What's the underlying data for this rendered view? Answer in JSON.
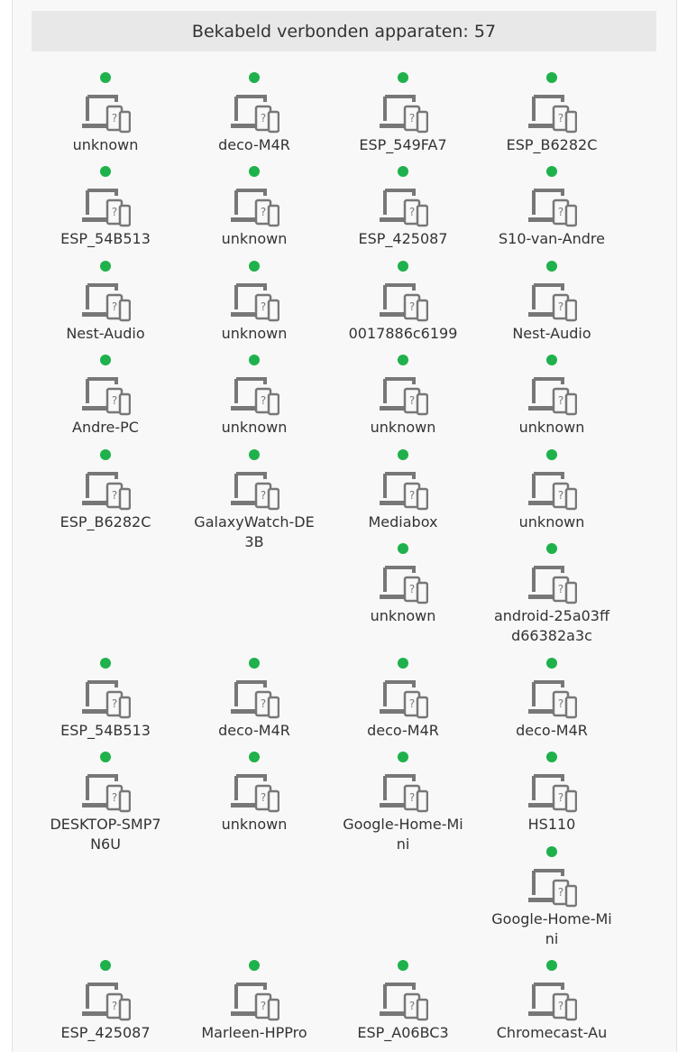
{
  "header": {
    "title": "Bekabeld verbonden apparaten: 57"
  },
  "colors": {
    "online": "#1fb14b",
    "icon": "#777777",
    "header_bg": "#e8e8e8"
  },
  "icon": "laptop-phone-unknown-device-icon",
  "devices": [
    {
      "name": "unknown",
      "status": "online"
    },
    {
      "name": "deco-M4R",
      "status": "online"
    },
    {
      "name": "ESP_549FA7",
      "status": "online"
    },
    {
      "name": "ESP_B6282C",
      "status": "online"
    },
    {
      "name": "ESP_54B513",
      "status": "online"
    },
    {
      "name": "unknown",
      "status": "online"
    },
    {
      "name": "ESP_425087",
      "status": "online"
    },
    {
      "name": "S10-van-Andre",
      "status": "online"
    },
    {
      "name": "Nest-Audio",
      "status": "online"
    },
    {
      "name": "unknown",
      "status": "online"
    },
    {
      "name": "0017886c6199",
      "status": "online"
    },
    {
      "name": "Nest-Audio",
      "status": "online"
    },
    {
      "name": "Andre-PC",
      "status": "online"
    },
    {
      "name": "unknown",
      "status": "online"
    },
    {
      "name": "unknown",
      "status": "online"
    },
    {
      "name": "unknown",
      "status": "online"
    },
    {
      "name": "ESP_B6282C",
      "status": "online"
    },
    {
      "name": "GalaxyWatch-DE3B",
      "status": "online"
    },
    {
      "name": "Mediabox",
      "status": "online"
    },
    {
      "name": "unknown",
      "status": "online"
    },
    {
      "name": "unknown",
      "status": "online"
    },
    {
      "name": "android-25a03ffd66382a3c",
      "status": "online"
    },
    {
      "name": "ESP_54B513",
      "status": "online"
    },
    {
      "name": "deco-M4R",
      "status": "online"
    },
    {
      "name": "deco-M4R",
      "status": "online"
    },
    {
      "name": "deco-M4R",
      "status": "online"
    },
    {
      "name": "DESKTOP-SMP7N6U",
      "status": "online"
    },
    {
      "name": "unknown",
      "status": "online"
    },
    {
      "name": "Google-Home-Mini",
      "status": "online"
    },
    {
      "name": "HS110",
      "status": "online"
    },
    {
      "name": "Google-Home-Mini",
      "status": "online"
    },
    {
      "name": "ESP_425087",
      "status": "online"
    },
    {
      "name": "Marleen-HPPro",
      "status": "online"
    },
    {
      "name": "ESP_A06BC3",
      "status": "online"
    },
    {
      "name": "Chromecast-Au",
      "status": "online"
    }
  ]
}
